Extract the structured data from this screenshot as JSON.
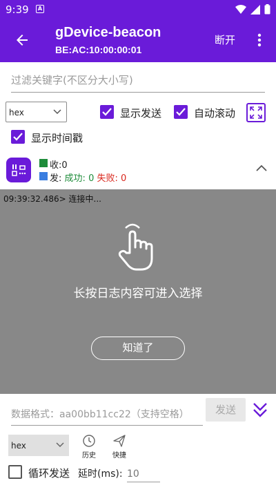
{
  "status_bar": {
    "time": "9:39",
    "notification_letter": "A"
  },
  "app_bar": {
    "title": "gDevice-beacon",
    "subtitle": "BE:AC:10:00:00:01",
    "disconnect_label": "断开"
  },
  "filter": {
    "placeholder": "过滤关键字(不区分大小写)",
    "value": ""
  },
  "display_format": {
    "selected": "hex"
  },
  "options": {
    "show_sent_label": "显示发送",
    "show_sent_checked": true,
    "auto_scroll_label": "自动滚动",
    "auto_scroll_checked": true,
    "show_timestamp_label": "显示时间戳",
    "show_timestamp_checked": true
  },
  "stats": {
    "recv_label": "收:",
    "recv_count": "0",
    "send_label": "发:",
    "success_label": "成功:",
    "success_count": "0",
    "fail_label": "失败:",
    "fail_count": "0"
  },
  "log": {
    "lines": [
      {
        "timestamp": "09:39:32.486>",
        "text": "连接中..."
      }
    ]
  },
  "overlay": {
    "hint": "长按日志内容可进入选择",
    "ok_label": "知道了"
  },
  "composer": {
    "data_placeholder": "数据格式：aa00bb11cc22（支持空格）",
    "send_label": "发送",
    "format_selected": "hex",
    "history_label": "历史",
    "quick_label": "快捷",
    "loop_send_label": "循环发送",
    "loop_send_checked": false,
    "delay_label": "延时(ms):",
    "delay_placeholder": "10"
  },
  "colors": {
    "primary": "#6a1bd9",
    "overlay_gray": "#888888",
    "success_green": "#1e8c3a",
    "fail_red": "#d9261c",
    "send_blue": "#3a7ee0"
  }
}
